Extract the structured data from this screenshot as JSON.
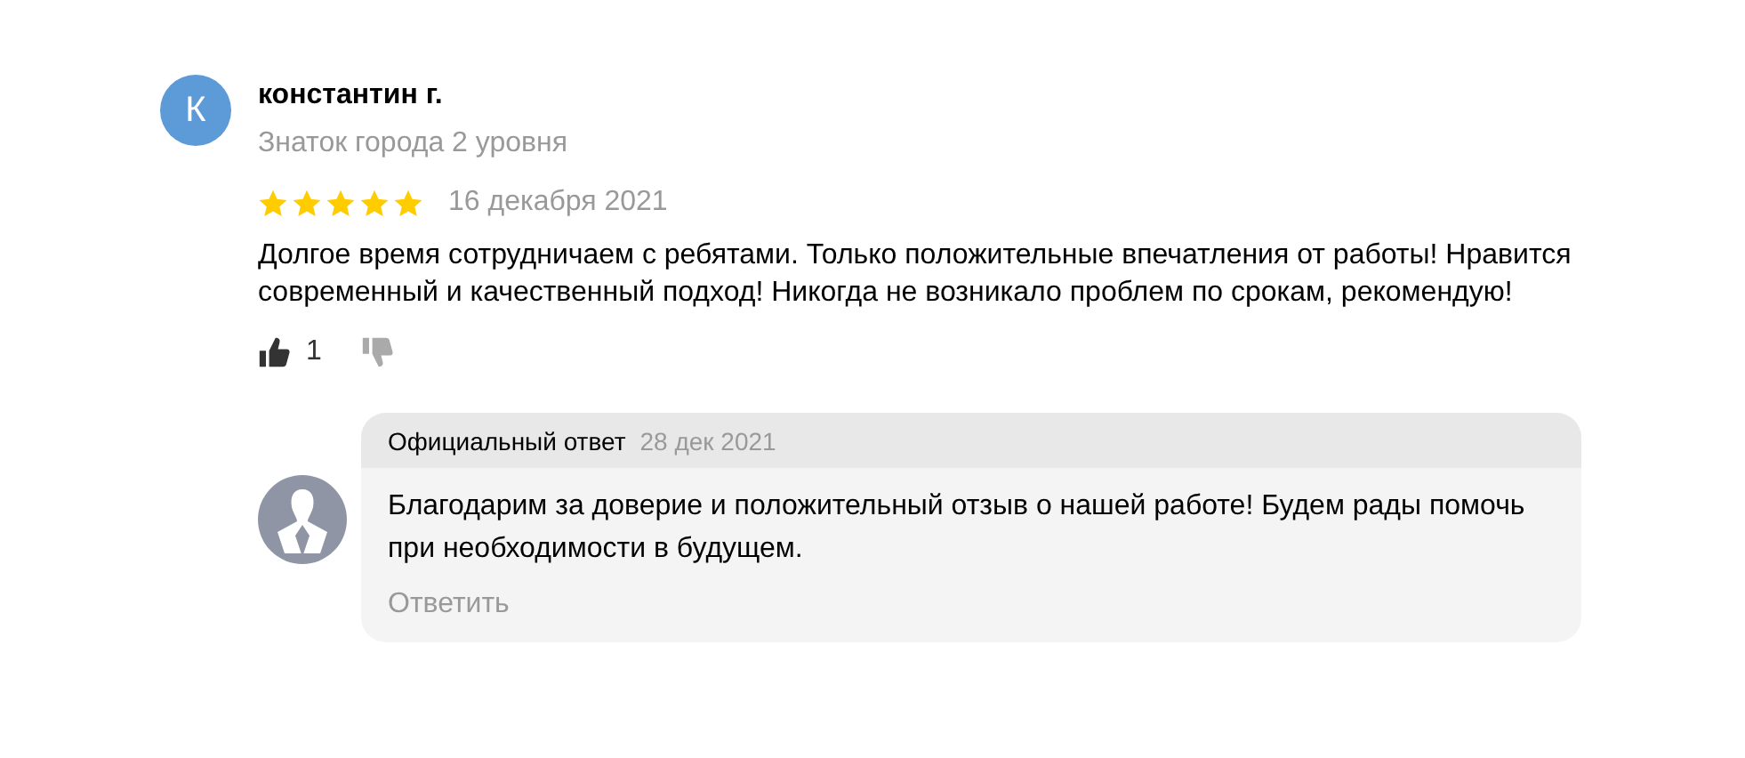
{
  "review": {
    "author": {
      "initial": "К",
      "name": "константин г.",
      "level": "Знаток города 2 уровня"
    },
    "stars": 5,
    "date": "16 декабря 2021",
    "text": "Долгое время сотрудничаем с ребятами. Только положительные впечатления от работы! Нравится современный и качественный подход! Никогда не возникало проблем по срокам, рекомендую!",
    "likes": "1"
  },
  "reply": {
    "title": "Официальный ответ",
    "date": "28 дек 2021",
    "text": "Благодарим за доверие и положительный отзыв о нашей работе! Будем рады помочь при необходимости в будущем.",
    "action": "Ответить"
  }
}
